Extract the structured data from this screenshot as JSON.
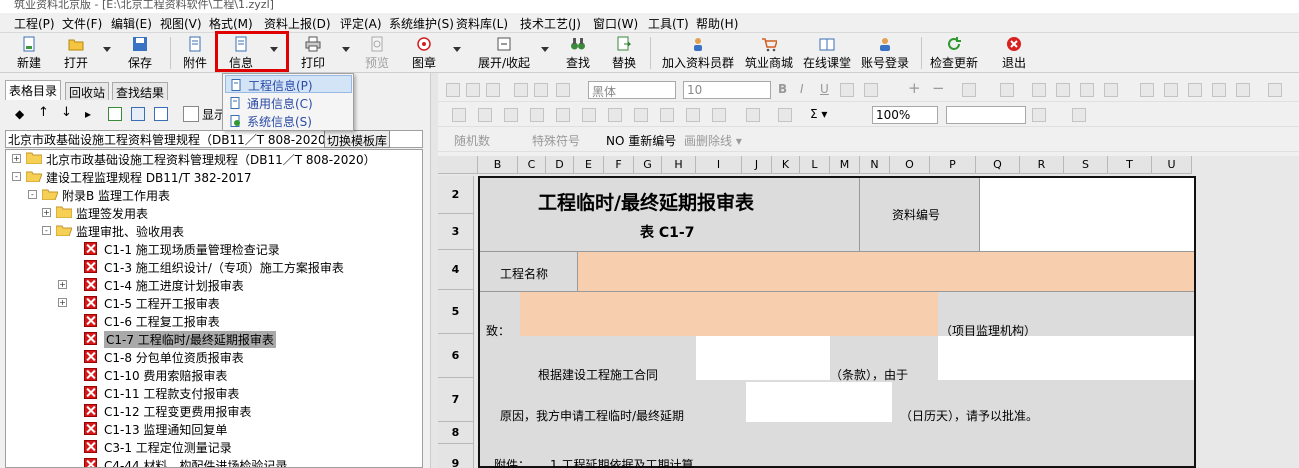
{
  "titlebar": {
    "text": "筑业资料北京版 - [E:\\北京工程资料软件\\工程\\1.zyzl]"
  },
  "menu": [
    "工程(P)",
    "文件(F)",
    "编辑(E)",
    "视图(V)",
    "格式(M)",
    "资料上报(D)",
    "评定(A)",
    "系统维护(S)",
    "资料库(L)",
    "技术工艺(J)",
    "窗口(W)",
    "工具(T)",
    "帮助(H)"
  ],
  "toolbar": {
    "new": "新建",
    "open": "打开",
    "save": "保存",
    "attach": "附件",
    "info": "信息",
    "print": "打印",
    "preview": "预览",
    "stamp": "图章",
    "expand": "展开/收起",
    "find": "查找",
    "replace": "替换",
    "join": "加入资料员群",
    "mall": "筑业商城",
    "classroom": "在线课堂",
    "login": "账号登录",
    "update": "检查更新",
    "exit": "退出"
  },
  "info_dropdown": [
    "工程信息(P)",
    "通用信息(C)",
    "系统信息(S)"
  ],
  "left_tabs": [
    "表格目录",
    "回收站",
    "查找结果"
  ],
  "left_toolbar": {
    "display": "显示"
  },
  "path": {
    "text": "北京市政基础设施工程资料管理规程（DB11／T 808-2020）",
    "switch": "切换模板库"
  },
  "tree": [
    {
      "label": "北京市政基础设施工程资料管理规程（DB11／T 808-2020）",
      "level": 0,
      "kind": "folder",
      "toggle": "+"
    },
    {
      "label": "建设工程监理规程 DB11/T 382-2017",
      "level": 0,
      "kind": "folder-open",
      "toggle": "-"
    },
    {
      "label": "附录B 监理工作用表",
      "level": 1,
      "kind": "folder-open",
      "toggle": "-"
    },
    {
      "label": "监理签发用表",
      "level": 2,
      "kind": "folder",
      "toggle": "+"
    },
    {
      "label": "监理审批、验收用表",
      "level": 2,
      "kind": "folder-open",
      "toggle": "-"
    },
    {
      "label": "C1-1 施工现场质量管理检查记录",
      "level": 3,
      "kind": "doc"
    },
    {
      "label": "C1-3 施工组织设计/（专项）施工方案报审表",
      "level": 3,
      "kind": "doc"
    },
    {
      "label": "C1-4 施工进度计划报审表",
      "level": 3,
      "kind": "doc",
      "toggle": "+"
    },
    {
      "label": "C1-5 工程开工报审表",
      "level": 3,
      "kind": "doc",
      "toggle": "+"
    },
    {
      "label": "C1-6 工程复工报审表",
      "level": 3,
      "kind": "doc"
    },
    {
      "label": "C1-7 工程临时/最终延期报审表",
      "level": 3,
      "kind": "doc",
      "selected": true
    },
    {
      "label": "C1-8 分包单位资质报审表",
      "level": 3,
      "kind": "doc"
    },
    {
      "label": "C1-10 费用索赔报审表",
      "level": 3,
      "kind": "doc"
    },
    {
      "label": "C1-11 工程款支付报审表",
      "level": 3,
      "kind": "doc"
    },
    {
      "label": "C1-12 工程变更费用报审表",
      "level": 3,
      "kind": "doc"
    },
    {
      "label": "C1-13 监理通知回复单",
      "level": 3,
      "kind": "doc"
    },
    {
      "label": "C3-1 工程定位测量记录",
      "level": 3,
      "kind": "doc"
    },
    {
      "label": "C4-44 材料、构配件进场检验记录",
      "level": 3,
      "kind": "doc"
    }
  ],
  "format_bar": {
    "font": "黑体",
    "size": "10",
    "zoom": "100%"
  },
  "extra_bar": {
    "random": "随机数",
    "special": "特殊符号",
    "renumber": "重新编号",
    "strike": "画删除线"
  },
  "columns": [
    "B",
    "C",
    "D",
    "E",
    "F",
    "G",
    "H",
    "I",
    "J",
    "K",
    "L",
    "M",
    "N",
    "O",
    "P",
    "Q",
    "R",
    "S",
    "T",
    "U"
  ],
  "rows": [
    "2",
    "3",
    "4",
    "5",
    "6",
    "7",
    "8",
    "9"
  ],
  "form": {
    "title": "工程临时/最终延期报审表",
    "subtitle": "表 C1-7",
    "doc_no": "资料编号",
    "project_name": "工程名称",
    "to": "致：",
    "supervisor": "（项目监理机构）",
    "contract": "根据建设工程施工合同",
    "clause": "（条款），由于",
    "reason": "原因，我方申请工程临时/最终延期",
    "days": "（日历天），请予以批准。",
    "attach": "附件：",
    "attach_item": "1.工程延期依据及工期计算"
  }
}
